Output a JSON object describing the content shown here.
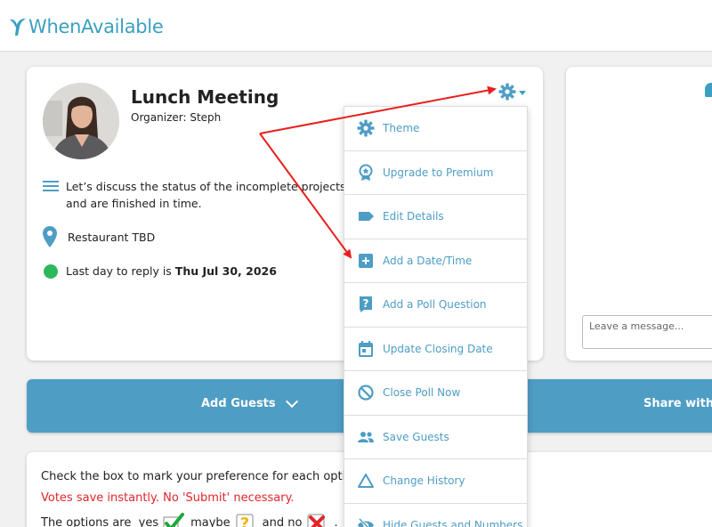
{
  "brand": {
    "name": "WhenAvailable"
  },
  "event": {
    "title": "Lunch Meeting",
    "organizer": "Organizer: Steph",
    "description": "Let’s discuss the status of the incomplete projects and are finished in time.",
    "location": "Restaurant TBD",
    "deadline_prefix": "Last day to reply is ",
    "deadline_date": "Thu Jul 30, 2026"
  },
  "chat": {
    "placeholder": "Leave a message..."
  },
  "guests_bar": {
    "add_label": "Add Guests",
    "share_label": "Share with"
  },
  "instructions": {
    "line1": "Check the box to mark your preference for each option",
    "line2": "Votes save instantly. No 'Submit' necessary.",
    "options_prefix": "The options are",
    "yes": "yes",
    "maybe": "maybe",
    "and_no": "and no",
    "suffix": "."
  },
  "menu": {
    "items": [
      {
        "label": "Theme",
        "icon": "gear-icon"
      },
      {
        "label": "Upgrade to Premium",
        "icon": "award-icon"
      },
      {
        "label": "Edit Details",
        "icon": "tag-icon"
      },
      {
        "label": "Add a Date/Time",
        "icon": "plus-square-icon"
      },
      {
        "label": "Add a Poll Question",
        "icon": "question-icon"
      },
      {
        "label": "Update Closing Date",
        "icon": "calendar-icon"
      },
      {
        "label": "Close Poll Now",
        "icon": "ban-icon"
      },
      {
        "label": "Save Guests",
        "icon": "users-icon"
      },
      {
        "label": "Change History",
        "icon": "triangle-icon"
      },
      {
        "label": "Hide Guests and Numbers",
        "icon": "eye-slash-icon"
      }
    ]
  },
  "colors": {
    "accent": "#4e9dc4",
    "brand": "#3c9fc2",
    "alert": "#e0262b",
    "status_green": "#2eb85c",
    "annotation_arrow": "#e8201d"
  }
}
